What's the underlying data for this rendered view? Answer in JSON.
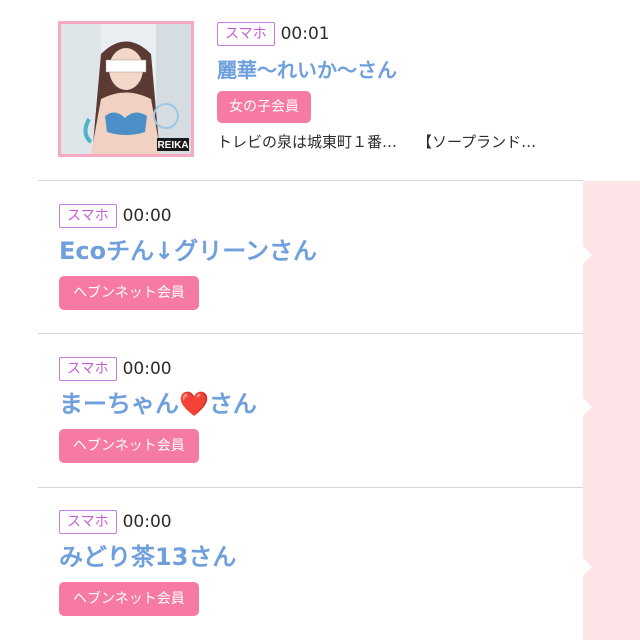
{
  "messages": [
    {
      "badge": "スマホ",
      "time": "00:01",
      "name": "麗華〜れいか〜さん",
      "member_label": "女の子会員",
      "snippet_left": "トレビの泉は城東町１番…",
      "snippet_right": "【ソープランド…",
      "thumbnail_caption": "REIKA"
    },
    {
      "badge": "スマホ",
      "time": "00:00",
      "name": "Ecoチん↓グリーンさん",
      "member_label": "ヘブンネット会員"
    },
    {
      "badge": "スマホ",
      "time": "00:00",
      "name_prefix": "まーちゃん",
      "name_heart": "❤️",
      "name_suffix": "さん",
      "member_label": "ヘブンネット会員"
    },
    {
      "badge": "スマホ",
      "time": "00:00",
      "name": "みどり茶13さん",
      "member_label": "ヘブンネット会員"
    }
  ],
  "colors": {
    "name_blue": "#6f9fdc",
    "badge_purple": "#c65fd6",
    "member_pink": "#f67aa3",
    "side_strip": "#fde4e6"
  }
}
